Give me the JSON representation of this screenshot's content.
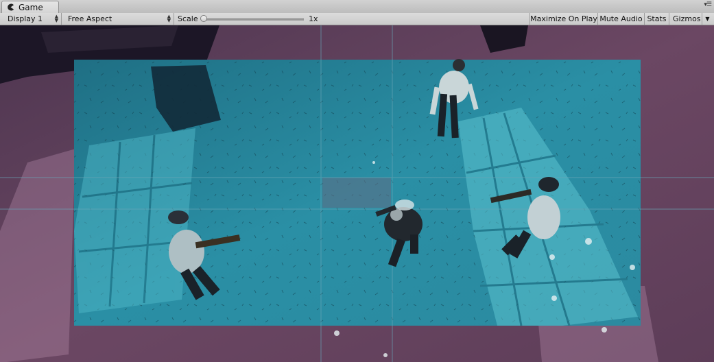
{
  "window": {
    "tab_title": "Game",
    "tab_icon": "pacman-game-icon",
    "menu_icon": "tab-menu-icon"
  },
  "toolbar": {
    "display": "Display 1",
    "aspect": "Free Aspect",
    "scale_label": "Scale",
    "scale_value": "1x",
    "scale_level": 0.0,
    "maximize": "Maximize On Play",
    "mute": "Mute Audio",
    "stats": "Stats",
    "gizmos": "Gizmos"
  },
  "colors": {
    "safe_area_overlay": "#2aa3b8",
    "outer_floor_tint": "#6a4460",
    "toolbar_bg": "#d0d0d0"
  }
}
